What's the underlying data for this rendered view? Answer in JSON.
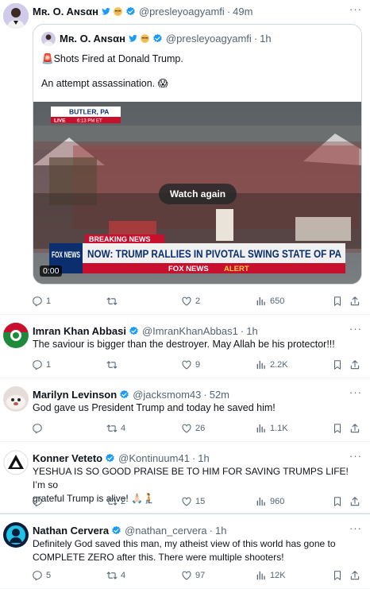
{
  "tweets": [
    {
      "name": "Mʀ. O. Aɴsαн",
      "handle": "@presleyoagyamfi",
      "time": "49m",
      "more": "···",
      "quote": {
        "name": "Mʀ. O. Aɴsαн",
        "handle": "@presleyoagyamfi",
        "time": "1h",
        "line1": "🚨Shots Fired at Donald Trump.",
        "line2": "An attempt assassination. 😱",
        "video": {
          "location": "BUTLER, PA",
          "live": "LIVE",
          "live_time": "6:13 PM ET",
          "breaking": "BREAKING NEWS",
          "channel": "FOX NEWS",
          "ticker_brand": "FOX NEWS",
          "ticker_word": "ALERT",
          "headline": "NOW: TRUMP RALLIES IN PIVOTAL SWING STATE OF PA",
          "watch_again": "Watch again",
          "timecode": "0:00"
        }
      },
      "replies": "1",
      "retweets": "",
      "likes": "2",
      "views": "650"
    },
    {
      "name": "Imran Khan Abbasi",
      "handle": "@ImranKhanAbbas1",
      "time": "1h",
      "more": "···",
      "text": "The saviour is bigger than the destroyer. May Allah be his protector!!!",
      "replies": "1",
      "retweets": "",
      "likes": "9",
      "views": "2.2K"
    },
    {
      "name": "Marilyn Levinson",
      "handle": "@jacksmom43",
      "time": "52m",
      "more": "···",
      "text": "God gave us President Trump and today he saved him!",
      "replies": "",
      "retweets": "4",
      "likes": "26",
      "views": "1.1K"
    },
    {
      "name": "Konner Veteto",
      "handle": "@Kontinuum41",
      "time": "1h",
      "more": "···",
      "text_line1": "YESHUA IS SO GOOD PRAISE BE TO HIM FOR SAVING TRUMPS LIFE! I’m so",
      "text_line2": "grateful Trump is alive! 🙏🏻🧎",
      "replies": "",
      "retweets": "2",
      "likes": "15",
      "views": "960"
    },
    {
      "name": "Nathan Cervera",
      "handle": "@nathan_cervera",
      "time": "1h",
      "more": "···",
      "text_line1": "Definitely God saved this man, my atheist view of this world has gone to",
      "text_line2": "COMPLETE ZERO after this. There were multiple shooters!",
      "replies": "5",
      "retweets": "4",
      "likes": "97",
      "views": "12K"
    }
  ],
  "colors": {
    "verified_blue": "#1d9bf0",
    "muted": "#536471",
    "fox_blue": "#0b2f6e",
    "breaking_red": "#c8102e"
  },
  "icons": [
    "reply-icon",
    "retweet-icon",
    "like-icon",
    "views-icon",
    "bookmark-icon",
    "share-icon",
    "verified-badge-icon",
    "blue-bird-icon",
    "emoji-badge-icon"
  ]
}
